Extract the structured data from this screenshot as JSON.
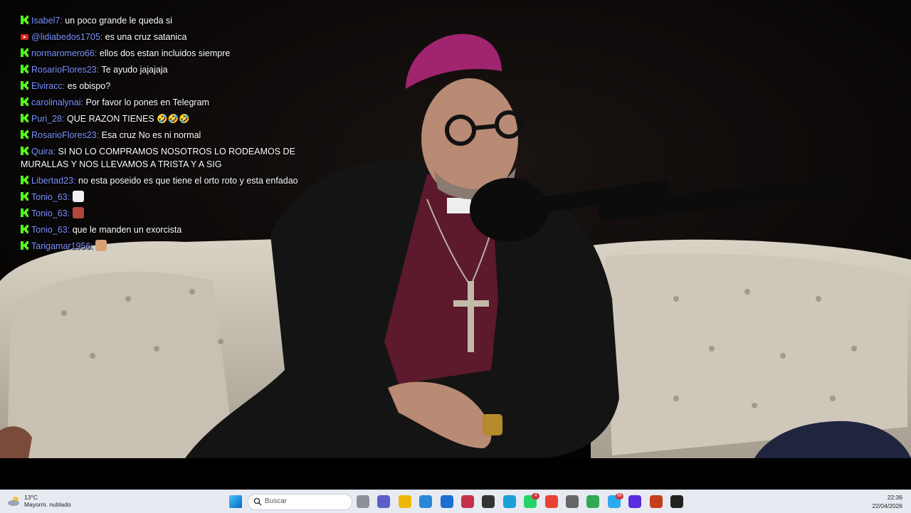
{
  "chat": {
    "messages": [
      {
        "platform": "kick",
        "user": "Isabel7:",
        "text": "un poco grande le queda si"
      },
      {
        "platform": "youtube",
        "user": "@lidiabedos1705:",
        "text": "es una cruz satanica"
      },
      {
        "platform": "kick",
        "user": "normaromero66:",
        "text": "ellos dos estan incluidos siempre"
      },
      {
        "platform": "kick",
        "user": "RosarioFlores23:",
        "text": "Te ayudo jajajaja"
      },
      {
        "platform": "kick",
        "user": "Elviracc:",
        "text": "es obispo?"
      },
      {
        "platform": "kick",
        "user": "carolinalynai:",
        "text": "Por favor lo pones en Telegram"
      },
      {
        "platform": "kick",
        "user": "Puri_28:",
        "text": "QUE RAZON TIENES 🤣🤣🤣"
      },
      {
        "platform": "kick",
        "user": "RosarioFlores23:",
        "text": "Esa cruz No es ni normal"
      },
      {
        "platform": "kick",
        "user": "Quira:",
        "text": "SI NO LO COMPRAMOS NOSOTROS LO RODEAMOS DE MURALLAS Y NOS LLEVAMOS A TRISTA Y A SIG"
      },
      {
        "platform": "kick",
        "user": "Libertad23:",
        "text": "no esta poseido es que tiene el orto roto y esta enfadao"
      },
      {
        "platform": "kick",
        "user": "Tonio_63:",
        "text": "",
        "emote": "ghost-emote"
      },
      {
        "platform": "kick",
        "user": "Tonio_63:",
        "text": "",
        "emote": "red-emote"
      },
      {
        "platform": "kick",
        "user": "Tonio_63:",
        "text": "que le manden un exorcista"
      },
      {
        "platform": "kick",
        "user": "Tarigamar1956:",
        "text": "",
        "emote": "hand-emote"
      }
    ],
    "colors": {
      "kick": "#53fc18",
      "username": "#7b93ff",
      "youtube": "#e62117"
    }
  },
  "taskbar": {
    "weather": {
      "temp": "13°C",
      "desc": "Mayorm. nublado",
      "icon": "cloud-sun-icon"
    },
    "search_placeholder": "Buscar",
    "apps": [
      {
        "name": "windows-start-icon"
      },
      {
        "name": "task-view-icon"
      },
      {
        "name": "teams-icon"
      },
      {
        "name": "file-explorer-icon"
      },
      {
        "name": "microsoft-store-icon"
      },
      {
        "name": "mail-icon"
      },
      {
        "name": "recorder-icon"
      },
      {
        "name": "dark-app-icon"
      },
      {
        "name": "edge-icon"
      },
      {
        "name": "whatsapp-icon",
        "badge": "4"
      },
      {
        "name": "chrome-icon"
      },
      {
        "name": "settings-icon"
      },
      {
        "name": "chrome-alt-icon"
      },
      {
        "name": "telegram-icon",
        "badge": "99"
      },
      {
        "name": "obs-icon"
      },
      {
        "name": "powerpoint-icon"
      },
      {
        "name": "media-player-icon"
      }
    ],
    "clock": {
      "time": "22:36",
      "date": "22/04/2026"
    }
  }
}
